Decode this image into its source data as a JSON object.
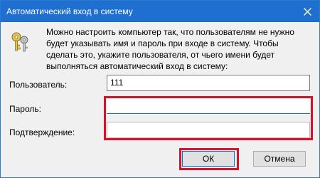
{
  "window": {
    "title": "Автоматический вход в систему",
    "accent_color": "#1f6fd1",
    "close_icon": "close-icon"
  },
  "description": "Можно настроить компьютер так, что пользователям не нужно будет указывать имя и пароль при входе в систему. Чтобы сделать это, укажите пользователя, от чьего имени будет выполняться автоматический вход в систему:",
  "icon": "keys-icon",
  "form": {
    "user_label": "Пользователь:",
    "user_value": "111",
    "password_label": "Пароль:",
    "password_value": "",
    "confirm_label": "Подтверждение:",
    "confirm_value": ""
  },
  "buttons": {
    "ok_label": "ОК",
    "cancel_label": "Отмена"
  },
  "highlight_color": "#d3132a"
}
